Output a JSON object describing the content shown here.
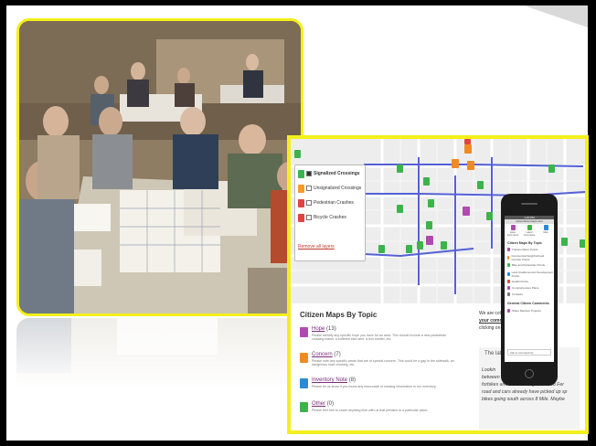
{
  "legend": {
    "items": [
      {
        "label": "Signalized Crossings",
        "color": "#3cb44b",
        "checked": true
      },
      {
        "label": "Unsignalized Crossings",
        "color": "#f39c2a",
        "checked": false
      },
      {
        "label": "Pedestrian Crashes",
        "color": "#e0443e",
        "checked": false
      },
      {
        "label": "Bicycle Crashes",
        "color": "#e0443e",
        "checked": false
      }
    ],
    "link": "Remove all layers"
  },
  "topics": {
    "title": "Citizen Maps By Topic",
    "items": [
      {
        "name": "Hope",
        "count": "(13)",
        "color": "#b04ab0",
        "desc": "Please identify any specific hope you have for an area. This should include a new pedestrian crossing island, a buffered bike lane, a bus shelter, etc."
      },
      {
        "name": "Concern",
        "count": "(7)",
        "color": "#f08a24",
        "desc": "Please note any specific areas that are of special concern. This could be a gap in the sidewalk, an dangerous road crossing, etc."
      },
      {
        "name": "Inventory Note",
        "count": "(8)",
        "color": "#2a8ad4",
        "desc": "Please let us know if you found any inaccurate or missing information in our inventory."
      },
      {
        "name": "Other",
        "count": "(0)",
        "color": "#3cb44b",
        "desc": "Please feel free to share anything else with us that pertains to a particular place."
      }
    ]
  },
  "right_text": {
    "lines": [
      "We are coll",
      "your comm",
      "clicking on"
    ],
    "latest_title": "The lat",
    "latest_lines": [
      "Lookin",
      "between",
      "forbikes and cars coming north into Fer",
      "road and cars already have picked up sp",
      "bikes going south across 8 Mile. Maybe"
    ]
  },
  "phone": {
    "time": "1:20 PM",
    "url": "www.citizenmaps.com",
    "tabs": [
      {
        "label": "Hope Comments",
        "color": "#b04ab0"
      },
      {
        "label": "Latest Comments",
        "color": "#3cb44b"
      },
      {
        "label": "Map",
        "color": "#2a8ad4"
      }
    ],
    "section1": "Citizen Maps By Topic",
    "items1": [
      {
        "label": "Transportation Points",
        "color": "#b04ab0"
      },
      {
        "label": "Commercial Neighborhood Corridor Points",
        "color": "#f08a24"
      },
      {
        "label": "Bike and Pedestrian Points",
        "color": "#3cb44b"
      },
      {
        "label": "Land Use/Economic Development Points",
        "color": "#2a8ad4"
      },
      {
        "label": "Health Points",
        "color": "#e0443e"
      },
      {
        "label": "Comprehensive Plans",
        "color": "#b04ab0"
      },
      {
        "label": "Contacts",
        "color": "#777777"
      }
    ],
    "section2": "General Citizen Comments",
    "items2": [
      {
        "label": "Share Random Projects",
        "color": "#b04ab0"
      }
    ],
    "input_placeholder": "Ask to comment by"
  }
}
